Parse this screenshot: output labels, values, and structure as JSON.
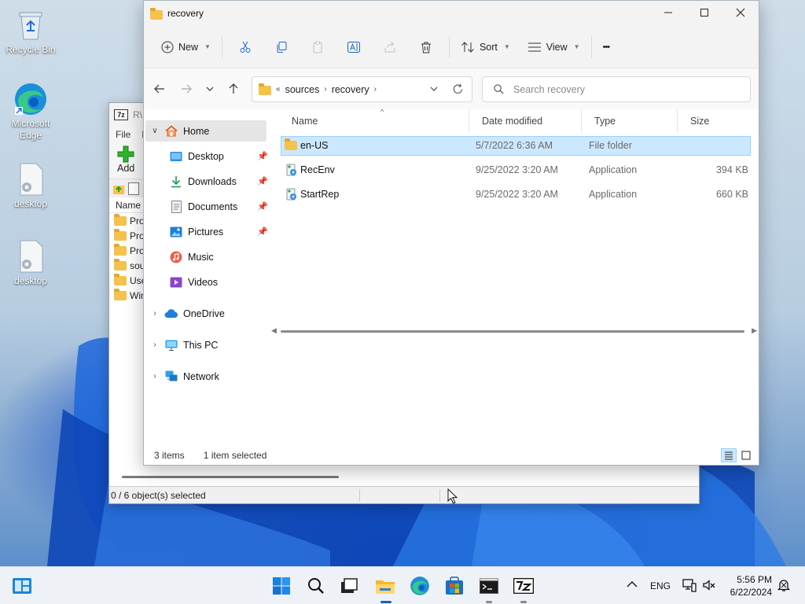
{
  "desktop": {
    "icons": [
      {
        "label": "Recycle Bin",
        "icon": "recycle-bin-icon"
      },
      {
        "label": "Microsoft Edge",
        "icon": "edge-icon"
      },
      {
        "label": "desktop",
        "icon": "settings-file-icon"
      },
      {
        "label": "desktop",
        "icon": "settings-file-icon"
      }
    ]
  },
  "zip_window": {
    "title": "R\\",
    "badge": "7z",
    "menu_file": "File",
    "menu_more": "E",
    "add_label": "Add",
    "header_name": "Name",
    "rows": [
      "Pro",
      "Prog",
      "Prog",
      "sou",
      "Use",
      "Win"
    ],
    "status": "0 / 6 object(s) selected"
  },
  "explorer": {
    "title": "recovery",
    "toolbar": {
      "new_label": "New",
      "sort_label": "Sort",
      "view_label": "View",
      "more_label": "•••"
    },
    "address": {
      "overflow": "«",
      "crumbs": [
        "sources",
        "recovery"
      ]
    },
    "search": {
      "placeholder": "Search recovery"
    },
    "nav": {
      "home": "Home",
      "quick_access": [
        {
          "label": "Desktop",
          "icon": "desktop-icon",
          "pinned": true
        },
        {
          "label": "Downloads",
          "icon": "download-icon",
          "pinned": true
        },
        {
          "label": "Documents",
          "icon": "documents-icon",
          "pinned": true
        },
        {
          "label": "Pictures",
          "icon": "pictures-icon",
          "pinned": true
        },
        {
          "label": "Music",
          "icon": "music-icon",
          "pinned": false
        },
        {
          "label": "Videos",
          "icon": "videos-icon",
          "pinned": false
        }
      ],
      "roots": [
        {
          "label": "OneDrive",
          "icon": "onedrive-icon"
        },
        {
          "label": "This PC",
          "icon": "this-pc-icon"
        },
        {
          "label": "Network",
          "icon": "network-icon"
        }
      ]
    },
    "columns": {
      "name": "Name",
      "date": "Date modified",
      "type": "Type",
      "size": "Size"
    },
    "files": [
      {
        "name": "en-US",
        "date": "5/7/2022 6:36 AM",
        "type": "File folder",
        "size": "",
        "icon": "folder-icon",
        "selected": true
      },
      {
        "name": "RecEnv",
        "date": "9/25/2022 3:20 AM",
        "type": "Application",
        "size": "394 KB",
        "icon": "application-icon",
        "selected": false
      },
      {
        "name": "StartRep",
        "date": "9/25/2022 3:20 AM",
        "type": "Application",
        "size": "660 KB",
        "icon": "application-icon",
        "selected": false
      }
    ],
    "status": {
      "count": "3 items",
      "selected": "1 item selected"
    }
  },
  "taskbar": {
    "language": "ENG",
    "time": "5:56 PM",
    "date": "6/22/2024",
    "apps": [
      "widgets-icon",
      "start-icon",
      "search-icon",
      "task-view-icon",
      "file-explorer-icon",
      "edge-icon",
      "store-icon",
      "terminal-icon",
      "7zip-icon"
    ]
  },
  "colors": {
    "accent": "#0067c0",
    "selection": "#cce8ff",
    "selection_border": "#99d1ff",
    "folder": "#f4c24d"
  }
}
